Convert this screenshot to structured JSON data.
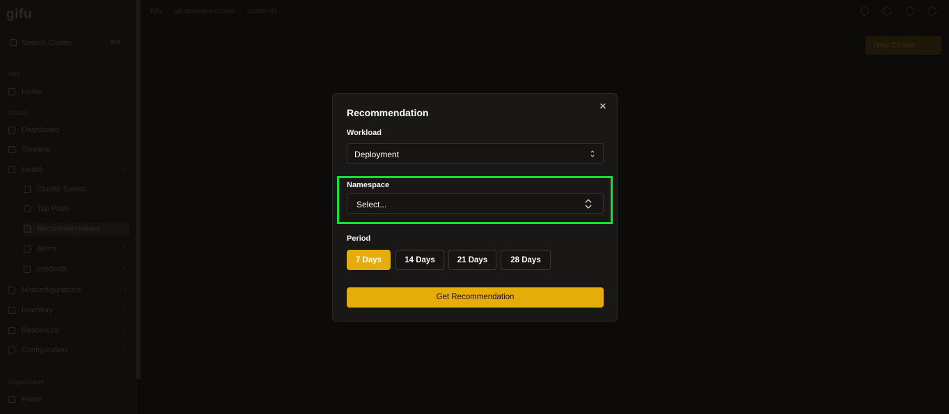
{
  "app": {
    "logo": "gifu",
    "search_label": "Search Cluster",
    "search_shortcut": "⌘K"
  },
  "breadcrumb": {
    "items": [
      "K8s",
      "gifuanalytics-cluster",
      "cluster-01"
    ]
  },
  "topbar": {
    "new_button_label": "New Cluster"
  },
  "sidebar": {
    "sections": [
      {
        "heading": "Hub",
        "items": [
          {
            "label": "Home"
          }
        ]
      },
      {
        "heading": "Cluster",
        "items": [
          {
            "label": "Dashboard"
          },
          {
            "label": "Timeline"
          },
          {
            "label": "Health"
          }
        ]
      }
    ],
    "health_sub": [
      {
        "label": "Cluster Events"
      },
      {
        "label": "Top Pods"
      },
      {
        "label": "Recommendations"
      },
      {
        "label": "Alerts"
      },
      {
        "label": "Incidents"
      }
    ],
    "cluster_more": [
      {
        "label": "Misconfigurations"
      },
      {
        "label": "Inventory"
      },
      {
        "label": "Resources"
      },
      {
        "label": "Configuration"
      }
    ],
    "org_heading": "Organization",
    "org_items": [
      {
        "label": "Home"
      }
    ]
  },
  "modal": {
    "title": "Recommendation",
    "workload": {
      "label": "Workload",
      "value": "Deployment"
    },
    "namespace": {
      "label": "Namespace",
      "value": "Select..."
    },
    "period": {
      "label": "Period",
      "options": [
        "7 Days",
        "14 Days",
        "21 Days",
        "28 Days"
      ],
      "selected": "7 Days"
    },
    "submit_label": "Get Recommendation"
  },
  "colors": {
    "accent": "#e6ac08",
    "highlight": "#17e22a",
    "modal_bg": "#191816"
  }
}
